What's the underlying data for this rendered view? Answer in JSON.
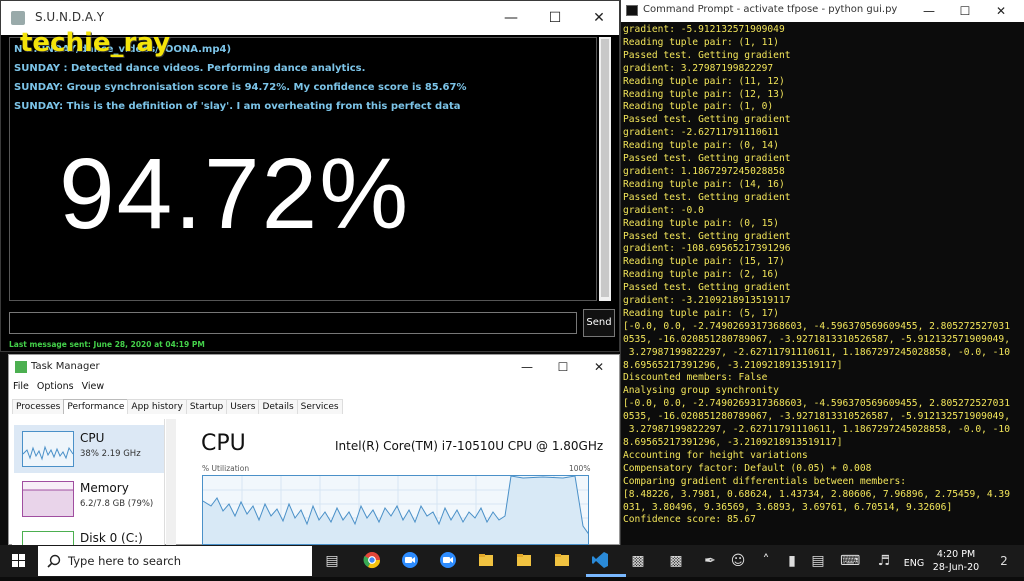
{
  "sunday": {
    "title": "S.U.N.D.A.Y",
    "log": [
      "N                 ...UNDAY/dance_videos/LOONA.mp4)",
      "SUNDAY : Detected dance videos. Performing dance analytics.",
      "SUNDAY: Group synchronisation score is 94.72%. My confidence score is 85.67%",
      "SUNDAY: This is the definition of 'slay'. I am overheating from this perfect data"
    ],
    "score": "94.72%",
    "message_value": "",
    "send_label": "Send",
    "last_message": "Last message sent: June 28, 2020 at 04:19 PM"
  },
  "watermark": "techie_ray",
  "cmd": {
    "title": "Command Prompt - activate  tfpose - python  gui.py",
    "lines": [
      "gradient: -5.912132571909049",
      "Reading tuple pair: (1, 11)",
      "Passed test. Getting gradient",
      "gradient: 3.27987199822297",
      "Reading tuple pair: (11, 12)",
      "Reading tuple pair: (12, 13)",
      "Reading tuple pair: (1, 0)",
      "Passed test. Getting gradient",
      "gradient: -2.62711791110611",
      "Reading tuple pair: (0, 14)",
      "Passed test. Getting gradient",
      "gradient: 1.1867297245028858",
      "Reading tuple pair: (14, 16)",
      "Passed test. Getting gradient",
      "gradient: -0.0",
      "Reading tuple pair: (0, 15)",
      "Passed test. Getting gradient",
      "gradient: -108.69565217391296",
      "Reading tuple pair: (15, 17)",
      "Reading tuple pair: (2, 16)",
      "Passed test. Getting gradient",
      "gradient: -3.2109218913519117",
      "Reading tuple pair: (5, 17)",
      "[-0.0, 0.0, -2.7490269317368603, -4.596370569609455, 2.805272527031",
      "0535, -16.020851280789067, -3.9271813310526587, -5.912132571909049,",
      " 3.27987199822297, -2.62711791110611, 1.1867297245028858, -0.0, -10",
      "8.69565217391296, -3.2109218913519117]",
      "Discounted members: False",
      "Analysing group synchronity",
      "[-0.0, 0.0, -2.7490269317368603, -4.596370569609455, 2.805272527031",
      "0535, -16.020851280789067, -3.9271813310526587, -5.912132571909049,",
      " 3.27987199822297, -2.62711791110611, 1.1867297245028858, -0.0, -10",
      "8.69565217391296, -3.2109218913519117]",
      "Accounting for height variations",
      "Compensatory factor: Default (0.05) + 0.008",
      "Comparing gradient differentials between members:",
      "[8.48226, 3.7981, 0.68624, 1.43734, 2.80606, 7.96896, 2.75459, 4.39",
      "031, 3.80496, 9.36569, 3.6893, 3.69761, 6.70514, 9.32606]",
      "Confidence score: 85.67"
    ]
  },
  "taskmgr": {
    "title": "Task Manager",
    "menu": [
      "File",
      "Options",
      "View"
    ],
    "tabs": [
      "Processes",
      "Performance",
      "App history",
      "Startup",
      "Users",
      "Details",
      "Services"
    ],
    "active_tab": "Performance",
    "side": [
      {
        "name": "CPU",
        "sub": "38%  2.19 GHz"
      },
      {
        "name": "Memory",
        "sub": "6.2/7.8 GB (79%)"
      },
      {
        "name": "Disk 0 (C:)",
        "sub": ""
      }
    ],
    "cpu_title": "CPU",
    "cpu_model": "Intel(R) Core(TM) i7-10510U CPU @ 1.80GHz",
    "util_label": "% Utilization",
    "util_max": "100%",
    "cpu_utilization_percent": 38
  },
  "taskbar": {
    "search_placeholder": "Type here to search",
    "lang": "ENG",
    "time": "4:20 PM",
    "date": "28-Jun-20",
    "notifications": "2"
  },
  "colors": {
    "log_text": "#7cc4e8",
    "console_text": "#f2e55a",
    "last_msg": "#44d14a",
    "watermark": "#f4e40a",
    "accent": "#4a90c8"
  }
}
